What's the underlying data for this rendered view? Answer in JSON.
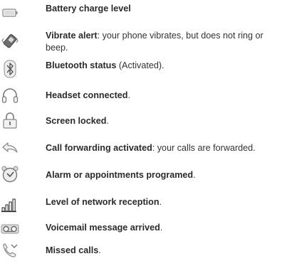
{
  "rows": [
    {
      "icon": "battery-icon",
      "title": "Battery charge level",
      "detail": ""
    },
    {
      "icon": "vibrate-icon",
      "title": "Vibrate alert",
      "detail": ": your phone vibrates, but does not ring or beep."
    },
    {
      "icon": "bluetooth-icon",
      "title": "Bluetooth status",
      "detail": " (Activated)."
    },
    {
      "icon": "headset-icon",
      "title": "Headset connected",
      "detail": "."
    },
    {
      "icon": "lock-icon",
      "title": "Screen locked",
      "detail": "."
    },
    {
      "icon": "call-forward-icon",
      "title": "Call forwarding activated",
      "detail": ": your calls are forwarded."
    },
    {
      "icon": "alarm-clock-icon",
      "title": "Alarm or appointments programed",
      "detail": "."
    },
    {
      "icon": "signal-bars-icon",
      "title": "Level of network reception",
      "detail": "."
    },
    {
      "icon": "voicemail-icon",
      "title": "Voicemail message arrived",
      "detail": "."
    },
    {
      "icon": "missed-call-icon",
      "title": "Missed calls",
      "detail": "."
    }
  ]
}
